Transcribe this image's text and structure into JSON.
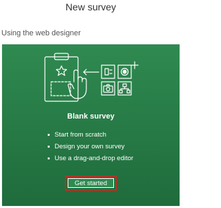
{
  "header": {
    "title": "New survey"
  },
  "section": {
    "label": "Using the web designer"
  },
  "card": {
    "title": "Blank survey",
    "bullets": [
      "Start from scratch",
      "Design your own survey",
      "Use a drag-and-drop editor"
    ],
    "button_label": "Get started",
    "background_color": "#2a7d49",
    "highlight_color": "#d0251e",
    "illustration_icons": [
      "clipboard-icon",
      "star-icon",
      "hand-pointer-icon",
      "question-type-icon",
      "radio-button-icon",
      "camera-icon",
      "hierarchy-icon",
      "plus-icon"
    ]
  }
}
